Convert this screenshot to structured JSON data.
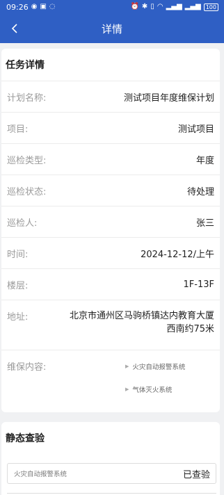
{
  "status_bar": {
    "time": "09:26",
    "battery": "100"
  },
  "header": {
    "title": "详情"
  },
  "task": {
    "section_title": "任务详情",
    "rows": [
      {
        "label": "计划名称:",
        "value": "测试项目年度维保计划"
      },
      {
        "label": "项目:",
        "value": "测试项目"
      },
      {
        "label": "巡检类型:",
        "value": "年度"
      },
      {
        "label": "巡检状态:",
        "value": "待处理"
      },
      {
        "label": "巡检人:",
        "value": "张三"
      },
      {
        "label": "时间:",
        "value": "2024-12-12/上午"
      },
      {
        "label": "楼层:",
        "value": "1F-13F"
      },
      {
        "label": "地址:",
        "value": "北京市通州区马驹桥镇达内教育大厦西南约75米"
      }
    ],
    "maintenance": {
      "label": "维保内容:",
      "items": [
        "火灾自动报警系统",
        "气体灭火系统"
      ]
    }
  },
  "static_check": {
    "section_title": "静态查验",
    "items": [
      {
        "system": "火灾自动报警系统",
        "status": "已查验"
      }
    ]
  }
}
